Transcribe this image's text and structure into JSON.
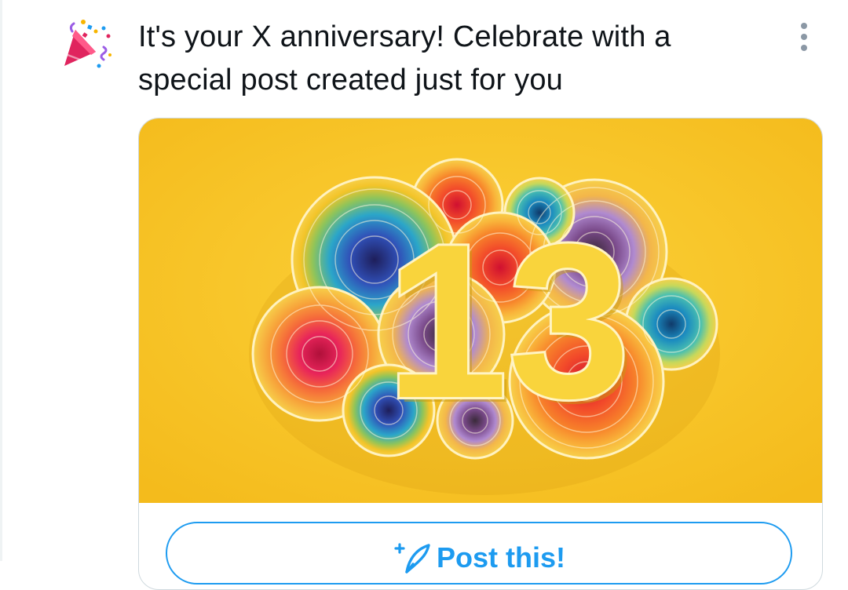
{
  "notification": {
    "icon": "party-popper-icon",
    "headline": "It's your X anniversary! Celebrate with a special post created just for you",
    "more_icon": "more-vertical-icon"
  },
  "card": {
    "image": {
      "icon": "anniversary-quilled-paper-artwork",
      "number": "13",
      "background_color": "#f7c326"
    },
    "post_button": {
      "icon": "compose-post-icon",
      "label": "Post this!",
      "color": "#1d9bf0"
    }
  }
}
